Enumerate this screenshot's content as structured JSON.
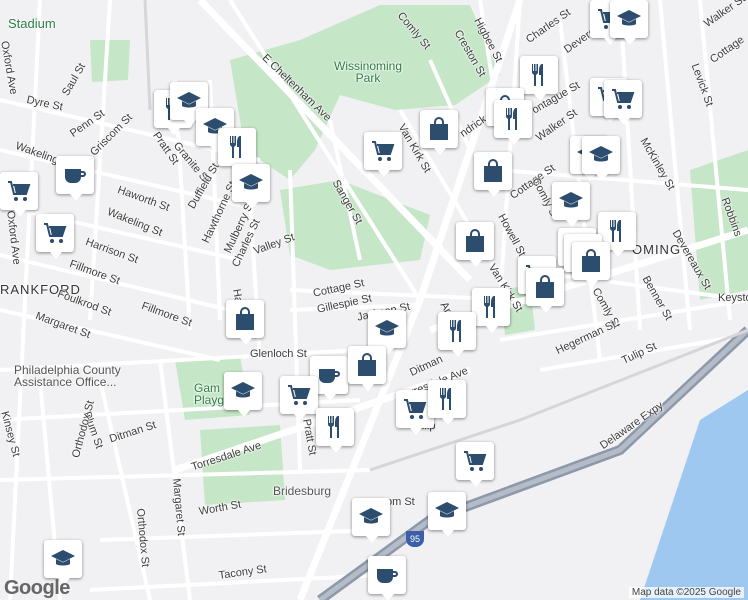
{
  "map": {
    "attribution": "Map data ©2025 Google",
    "logo": "Google",
    "highway_shield": "95"
  },
  "labels": {
    "stadium": "Stadium",
    "wissinoming_park": "Wissinoming\nPark",
    "wissinoming": "OMING",
    "frankford": "RANKFORD",
    "philadelphia_county": "Philadelphia County\nAssistance Office...",
    "gambrel_playground": "Gam\nPlaygr",
    "bridesburg": "Bridesburg",
    "e_cheltenham_ave": "E Cheltenham Ave",
    "comly_st_top": "Comly St",
    "higbee_st": "Higbee St",
    "creston_st": "Creston St",
    "charles_st_top": "Charles St",
    "devereaux_st_top": "Devereaux St",
    "walker_st_tr": "Walker St",
    "cottage_st_tr": "Cottage",
    "levick_st": "Levick St",
    "robbins": "Robbins",
    "keystone": "Keyston",
    "oxford_ave_top": "Oxford Ave",
    "dyre_st": "Dyre St",
    "saul_st": "Saul St",
    "wakeling_st_l": "Wakeling St",
    "penn_st": "Penn St",
    "griscom_st": "Griscom St",
    "granite_st": "Granite St",
    "pratt_st_top": "Pratt St",
    "haworth_st": "Haworth St",
    "wakeling_st": "Wakeling St",
    "duffield_st": "Duffield St",
    "hawthorne_st": "Hawthorne St",
    "mulberry_st": "Mulberry St",
    "charles_st_mid": "Charles St",
    "valley_st": "Valley St",
    "harrison_st": "Harrison St",
    "fillmore_st_l": "Fillmore St",
    "foulkrod_st": "Foulkrod St",
    "margaret_st_l": "Margaret St",
    "fillmore_st": "Fillmore St",
    "oxford_ave": "Oxford Ave",
    "sanger_st": "Sanger St",
    "van_kirk_st_top": "Van Kirk St",
    "hendrick_st": "ndrick St",
    "walker_st": "Walker St",
    "montague_st": "ontague St",
    "mckinley_st": "McKinley St",
    "cottage_st_r": "Cottage St",
    "comly_st_mid": "Comly St",
    "howell_st": "Howell St",
    "devereaux_st_r": "Devereaux St",
    "benner_st": "Benner St",
    "comly_st_r": "Comly St",
    "van_kirk_st": "Van Kirk St",
    "cottage_st": "Cottage St",
    "gillespie_st": "Gillespie St",
    "jackson_st": "Jackson St",
    "harbison_ave": "Harbison Ave",
    "ditman_st": "Ditman",
    "hegerman_st": "Hegerman St",
    "tulip_st_r": "Tulip St",
    "glenloch_st": "Glenloch St",
    "torresdale_ave": "Torresdale Ave",
    "torresdale_ave_r": "Torresdale Ave",
    "tulip_st": "Tulip",
    "plum_st": "Plum St",
    "ditman_st_l": "Ditman St",
    "orthodox_st": "Orthodox St",
    "orthodox_st_b": "Orthodox St",
    "margaret_st": "Margaret St",
    "pratt_st": "Pratt St",
    "kinsey_st": "Kinsey St",
    "worth_st": "Worth St",
    "tacony_st": "Tacony St",
    "delaware_expy": "Delaware Expy",
    "edgemont_st": "om St",
    "ar_ave": "Ar",
    "harvey": "Hav",
    "lt_st": "on Ave"
  },
  "markers": [
    {
      "type": "restaurant",
      "name": "restaurant"
    },
    {
      "type": "shopping",
      "name": "shopping"
    },
    {
      "type": "school",
      "name": "school"
    },
    {
      "type": "cafe",
      "name": "cafe"
    }
  ],
  "colors": {
    "marker_icon": "#2c4d6e",
    "park": "#c6e6c8",
    "water": "#9ec8f0",
    "road": "#ffffff",
    "highway": "#8d98a8"
  }
}
